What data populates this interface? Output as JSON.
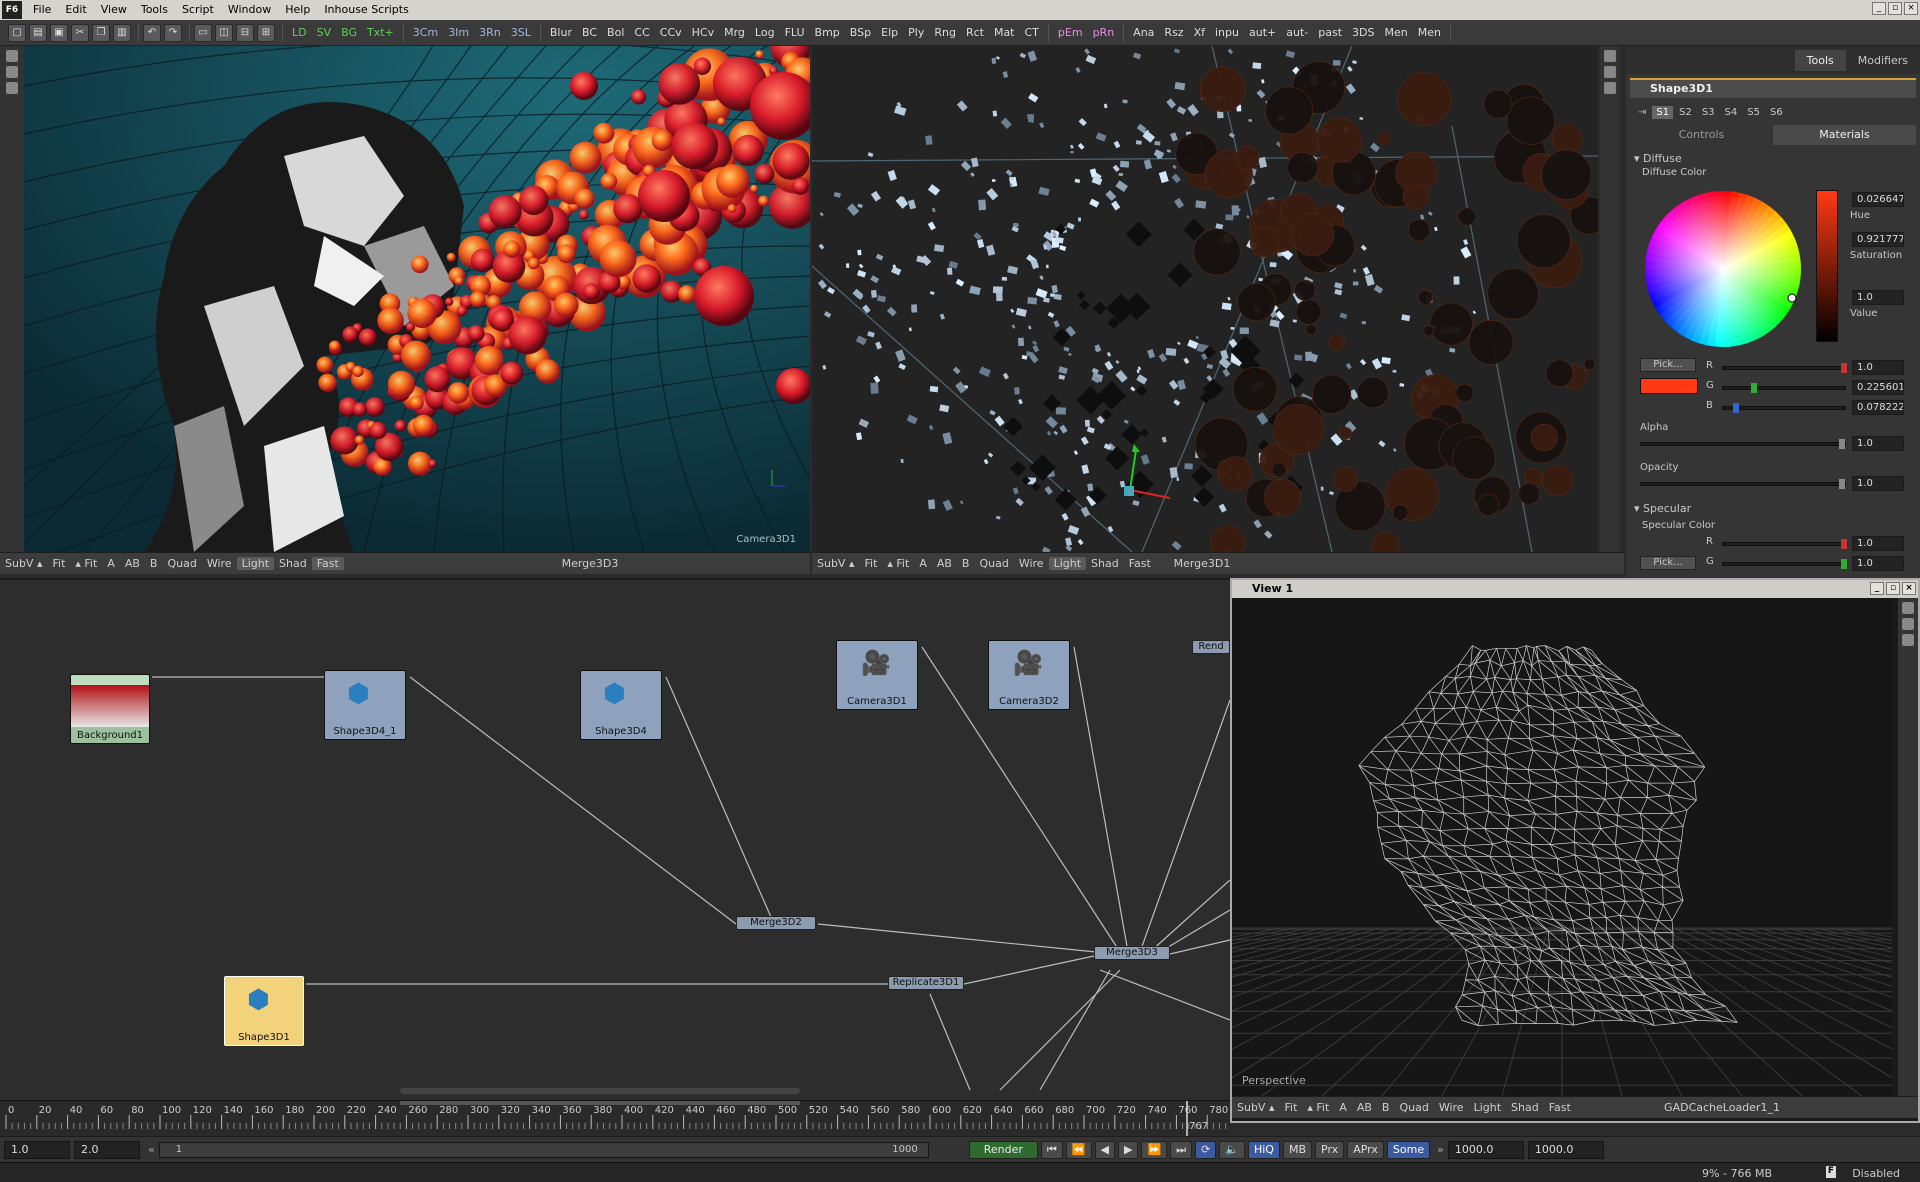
{
  "app": {
    "logo": "F6"
  },
  "menu": [
    "File",
    "Edit",
    "View",
    "Tools",
    "Script",
    "Window",
    "Help",
    "Inhouse Scripts"
  ],
  "window_buttons": [
    "_",
    "▫",
    "×"
  ],
  "toolbar": {
    "groups": [
      {
        "color": "g",
        "items": [
          "LD",
          "SV",
          "BG",
          "Txt+"
        ]
      },
      {
        "color": "b",
        "items": [
          "3Cm",
          "3Im",
          "3Rn",
          "3SL"
        ]
      },
      {
        "color": "w",
        "items": [
          "Blur",
          "BC",
          "Bol",
          "CC",
          "CCv",
          "HCv",
          "Mrg",
          "Log",
          "FLU",
          "Bmp",
          "BSp",
          "Elp",
          "Ply",
          "Rng",
          "Rct",
          "Mat",
          "CT"
        ]
      },
      {
        "color": "p",
        "items": [
          "pEm",
          "pRn"
        ]
      },
      {
        "color": "w",
        "items": [
          "Ana",
          "Rsz",
          "Xf",
          "inpu",
          "aut+",
          "aut-",
          "past",
          "3DS",
          "Men",
          "Men"
        ]
      }
    ]
  },
  "viewer_left": {
    "camera_label": "Camera3D1",
    "bar": {
      "items": [
        "SubV ▴",
        "Fit",
        "▴ Fit",
        "A",
        "AB",
        "B",
        "Quad",
        "Wire",
        "Light",
        "Shad",
        "Fast"
      ],
      "active": [
        "Light",
        "Fast"
      ],
      "title": "Merge3D3"
    }
  },
  "viewer_right": {
    "bar": {
      "items": [
        "SubV ▴",
        "Fit",
        "▴ Fit",
        "A",
        "AB",
        "B",
        "Quad",
        "Wire",
        "Light",
        "Shad",
        "Fast"
      ],
      "active": [
        "Light"
      ],
      "title": "Merge3D1"
    }
  },
  "inspector": {
    "tabs": [
      "Tools",
      "Modifiers"
    ],
    "tool_name": "Shape3D1",
    "subtabs": [
      "S1",
      "S2",
      "S3",
      "S4",
      "S5",
      "S6"
    ],
    "ctabs": [
      "Controls",
      "Materials"
    ],
    "diffuse": {
      "section": "Diffuse",
      "color_label": "Diffuse Color",
      "hue_value": "0.026647",
      "hue_label": "Hue",
      "sat_value": "0.921777",
      "sat_label": "Saturation",
      "val_value": "1.0",
      "val_label": "Value",
      "pick": "Pick...",
      "r_label": "R",
      "r_value": "1.0",
      "g_label": "G",
      "g_value": "0.225601",
      "b_label": "B",
      "b_value": "0.078222",
      "swatch": "#ff3a14",
      "alpha_label": "Alpha",
      "alpha_value": "1.0",
      "opacity_label": "Opacity",
      "opacity_value": "1.0"
    },
    "specular": {
      "section": "Specular",
      "color_label": "Specular Color",
      "r_label": "R",
      "r_value": "1.0",
      "pick": "Pick...",
      "g_label": "G",
      "g_value": "1.0"
    }
  },
  "flow": {
    "nodes": {
      "background1": "Background1",
      "shape3d4_1": "Shape3D4_1",
      "shape3d4": "Shape3D4",
      "camera3d1": "Camera3D1",
      "camera3d2": "Camera3D2",
      "render": "Rend",
      "merge3d2": "Merge3D2",
      "merge3d3": "Merge3D3",
      "replicate3d1": "Replicate3D1",
      "shape3d1": "Shape3D1"
    }
  },
  "view1": {
    "title": "View 1",
    "perspective": "Perspective",
    "bar": {
      "items": [
        "SubV ▴",
        "Fit",
        "▴ Fit",
        "A",
        "AB",
        "B",
        "Quad",
        "Wire",
        "Light",
        "Shad",
        "Fast"
      ],
      "title": "GADCacheLoader1_1"
    }
  },
  "timeline": {
    "ticks": [
      "0",
      "20",
      "40",
      "60",
      "80",
      "100",
      "120",
      "140",
      "160",
      "180",
      "200",
      "220",
      "240",
      "260",
      "280",
      "300",
      "320",
      "340",
      "360",
      "380",
      "400",
      "420",
      "440",
      "460",
      "480",
      "500",
      "520",
      "540",
      "560",
      "580",
      "600",
      "620",
      "640",
      "660",
      "680",
      "700",
      "720",
      "740",
      "760",
      "780"
    ],
    "current": "767"
  },
  "transport": {
    "start": "1.0",
    "end": "2.0",
    "range_start": "1",
    "range_end": "1000",
    "render": "Render",
    "hiq": "HiQ",
    "mb": "MB",
    "prx": "Prx",
    "aprx": "APrx",
    "some": "Some",
    "global_start": "1000.0",
    "global_end": "1000.0"
  },
  "status": {
    "memory": "9% - 766 MB",
    "state": "Disabled"
  }
}
